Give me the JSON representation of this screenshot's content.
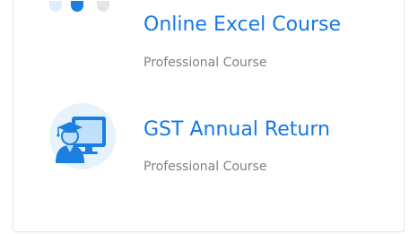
{
  "carousel": {
    "dots": [
      {
        "state": "inactive",
        "color": "#dceefb"
      },
      {
        "state": "active",
        "color": "#1a7fe0"
      },
      {
        "state": "inactive",
        "color": "#e2e4e7"
      }
    ]
  },
  "courses": [
    {
      "title": "Online Excel Course",
      "subtitle": "Professional Course",
      "icon": "none"
    },
    {
      "title": "GST Annual Return",
      "subtitle": "Professional Course",
      "icon": "graduate-computer-icon"
    }
  ],
  "colors": {
    "link": "#1877e6",
    "subtitle": "#7c8186",
    "border": "#e3e6ea",
    "icon_blue": "#1a7fe0",
    "icon_bg": "#e6f3fd"
  }
}
